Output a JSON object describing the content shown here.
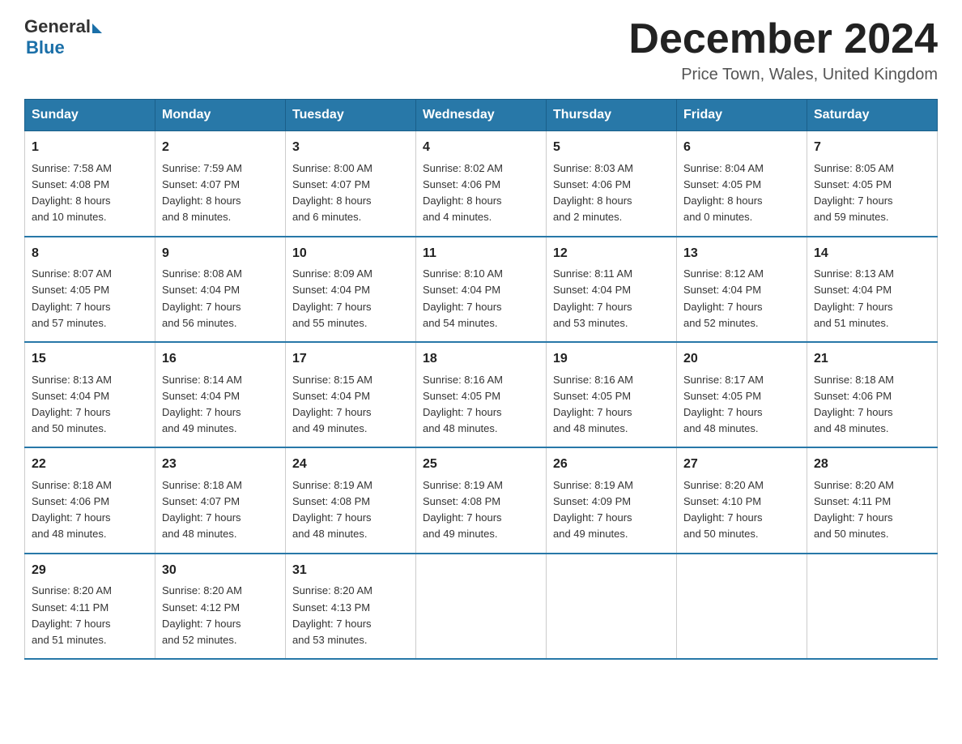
{
  "header": {
    "logo_general": "General",
    "logo_blue": "Blue",
    "title": "December 2024",
    "location": "Price Town, Wales, United Kingdom"
  },
  "days_of_week": [
    "Sunday",
    "Monday",
    "Tuesday",
    "Wednesday",
    "Thursday",
    "Friday",
    "Saturday"
  ],
  "weeks": [
    [
      {
        "num": "1",
        "info": "Sunrise: 7:58 AM\nSunset: 4:08 PM\nDaylight: 8 hours\nand 10 minutes."
      },
      {
        "num": "2",
        "info": "Sunrise: 7:59 AM\nSunset: 4:07 PM\nDaylight: 8 hours\nand 8 minutes."
      },
      {
        "num": "3",
        "info": "Sunrise: 8:00 AM\nSunset: 4:07 PM\nDaylight: 8 hours\nand 6 minutes."
      },
      {
        "num": "4",
        "info": "Sunrise: 8:02 AM\nSunset: 4:06 PM\nDaylight: 8 hours\nand 4 minutes."
      },
      {
        "num": "5",
        "info": "Sunrise: 8:03 AM\nSunset: 4:06 PM\nDaylight: 8 hours\nand 2 minutes."
      },
      {
        "num": "6",
        "info": "Sunrise: 8:04 AM\nSunset: 4:05 PM\nDaylight: 8 hours\nand 0 minutes."
      },
      {
        "num": "7",
        "info": "Sunrise: 8:05 AM\nSunset: 4:05 PM\nDaylight: 7 hours\nand 59 minutes."
      }
    ],
    [
      {
        "num": "8",
        "info": "Sunrise: 8:07 AM\nSunset: 4:05 PM\nDaylight: 7 hours\nand 57 minutes."
      },
      {
        "num": "9",
        "info": "Sunrise: 8:08 AM\nSunset: 4:04 PM\nDaylight: 7 hours\nand 56 minutes."
      },
      {
        "num": "10",
        "info": "Sunrise: 8:09 AM\nSunset: 4:04 PM\nDaylight: 7 hours\nand 55 minutes."
      },
      {
        "num": "11",
        "info": "Sunrise: 8:10 AM\nSunset: 4:04 PM\nDaylight: 7 hours\nand 54 minutes."
      },
      {
        "num": "12",
        "info": "Sunrise: 8:11 AM\nSunset: 4:04 PM\nDaylight: 7 hours\nand 53 minutes."
      },
      {
        "num": "13",
        "info": "Sunrise: 8:12 AM\nSunset: 4:04 PM\nDaylight: 7 hours\nand 52 minutes."
      },
      {
        "num": "14",
        "info": "Sunrise: 8:13 AM\nSunset: 4:04 PM\nDaylight: 7 hours\nand 51 minutes."
      }
    ],
    [
      {
        "num": "15",
        "info": "Sunrise: 8:13 AM\nSunset: 4:04 PM\nDaylight: 7 hours\nand 50 minutes."
      },
      {
        "num": "16",
        "info": "Sunrise: 8:14 AM\nSunset: 4:04 PM\nDaylight: 7 hours\nand 49 minutes."
      },
      {
        "num": "17",
        "info": "Sunrise: 8:15 AM\nSunset: 4:04 PM\nDaylight: 7 hours\nand 49 minutes."
      },
      {
        "num": "18",
        "info": "Sunrise: 8:16 AM\nSunset: 4:05 PM\nDaylight: 7 hours\nand 48 minutes."
      },
      {
        "num": "19",
        "info": "Sunrise: 8:16 AM\nSunset: 4:05 PM\nDaylight: 7 hours\nand 48 minutes."
      },
      {
        "num": "20",
        "info": "Sunrise: 8:17 AM\nSunset: 4:05 PM\nDaylight: 7 hours\nand 48 minutes."
      },
      {
        "num": "21",
        "info": "Sunrise: 8:18 AM\nSunset: 4:06 PM\nDaylight: 7 hours\nand 48 minutes."
      }
    ],
    [
      {
        "num": "22",
        "info": "Sunrise: 8:18 AM\nSunset: 4:06 PM\nDaylight: 7 hours\nand 48 minutes."
      },
      {
        "num": "23",
        "info": "Sunrise: 8:18 AM\nSunset: 4:07 PM\nDaylight: 7 hours\nand 48 minutes."
      },
      {
        "num": "24",
        "info": "Sunrise: 8:19 AM\nSunset: 4:08 PM\nDaylight: 7 hours\nand 48 minutes."
      },
      {
        "num": "25",
        "info": "Sunrise: 8:19 AM\nSunset: 4:08 PM\nDaylight: 7 hours\nand 49 minutes."
      },
      {
        "num": "26",
        "info": "Sunrise: 8:19 AM\nSunset: 4:09 PM\nDaylight: 7 hours\nand 49 minutes."
      },
      {
        "num": "27",
        "info": "Sunrise: 8:20 AM\nSunset: 4:10 PM\nDaylight: 7 hours\nand 50 minutes."
      },
      {
        "num": "28",
        "info": "Sunrise: 8:20 AM\nSunset: 4:11 PM\nDaylight: 7 hours\nand 50 minutes."
      }
    ],
    [
      {
        "num": "29",
        "info": "Sunrise: 8:20 AM\nSunset: 4:11 PM\nDaylight: 7 hours\nand 51 minutes."
      },
      {
        "num": "30",
        "info": "Sunrise: 8:20 AM\nSunset: 4:12 PM\nDaylight: 7 hours\nand 52 minutes."
      },
      {
        "num": "31",
        "info": "Sunrise: 8:20 AM\nSunset: 4:13 PM\nDaylight: 7 hours\nand 53 minutes."
      },
      {
        "num": "",
        "info": ""
      },
      {
        "num": "",
        "info": ""
      },
      {
        "num": "",
        "info": ""
      },
      {
        "num": "",
        "info": ""
      }
    ]
  ]
}
